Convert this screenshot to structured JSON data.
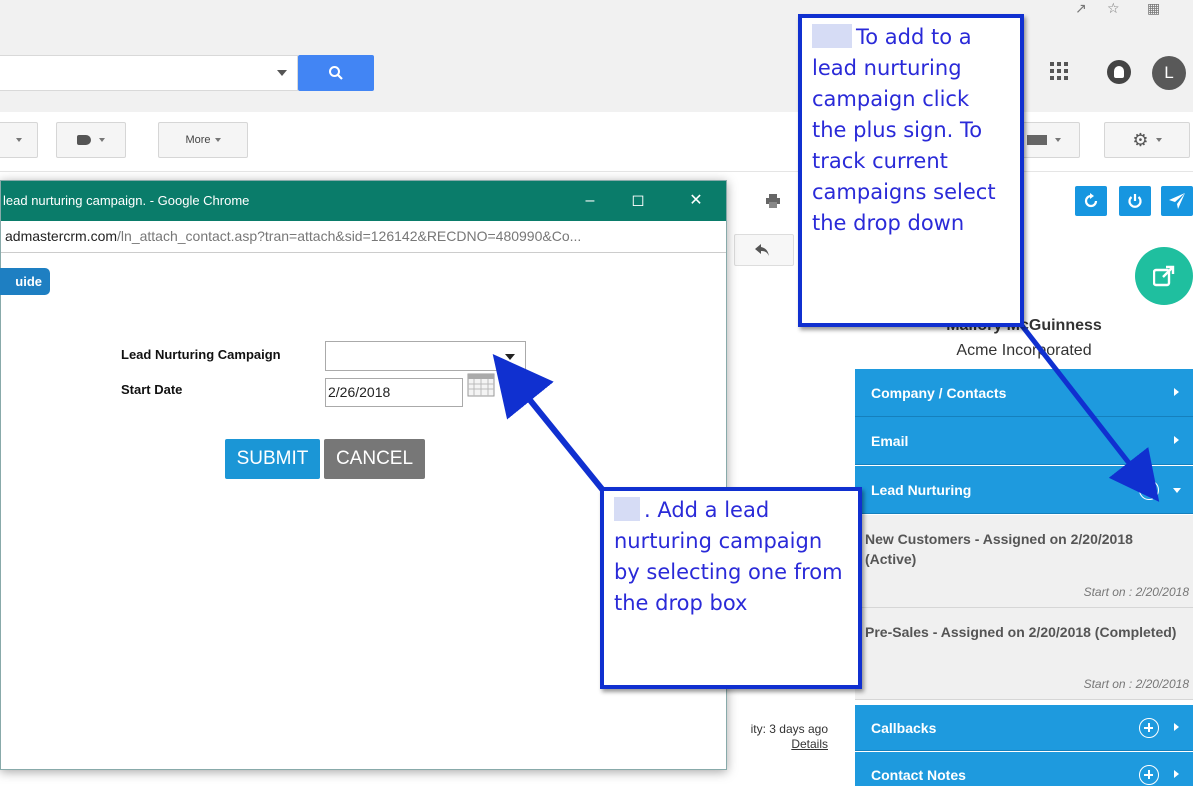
{
  "gmail": {
    "more_label": "More",
    "activity_text": "ity: 3 days ago",
    "details_link": "Details",
    "avatar_letter": "L"
  },
  "popup": {
    "window_title": "lead nurturing campaign. - Google Chrome",
    "url_host": "admastercrm.com",
    "url_path": "/ln_attach_contact.asp?tran=attach&sid=126142&RECDNO=480990&Co...",
    "guide_label": "uide",
    "campaign_label": "Lead Nurturing Campaign",
    "start_date_label": "Start Date",
    "start_date_value": "2/26/2018",
    "submit_label": "SUBMIT",
    "cancel_label": "CANCEL"
  },
  "crm": {
    "contact_name": "Mallory McGuinness",
    "company_name": "Acme Incorporated",
    "sections": {
      "company_contacts": "Company / Contacts",
      "email": "Email",
      "lead_nurturing": "Lead Nurturing",
      "callbacks": "Callbacks",
      "contact_notes": "Contact Notes"
    },
    "campaigns": [
      {
        "title": "New Customers - Assigned on 2/20/2018 (Active)",
        "start": "Start on : 2/20/2018"
      },
      {
        "title": "Pre-Sales - Assigned on 2/20/2018 (Completed)",
        "start": "Start on : 2/20/2018"
      }
    ]
  },
  "annotations": {
    "top_callout": "To add to a lead nurturing campaign click the plus sign. To track current campaigns select the drop down",
    "bottom_callout": ". Add a lead nurturing campaign by selecting one from the drop box"
  },
  "colors": {
    "crm_blue": "#1e9ade",
    "popup_titlebar": "#0a7c6a",
    "annotation_blue": "#1030d0",
    "launch_green": "#1fbf9f"
  }
}
